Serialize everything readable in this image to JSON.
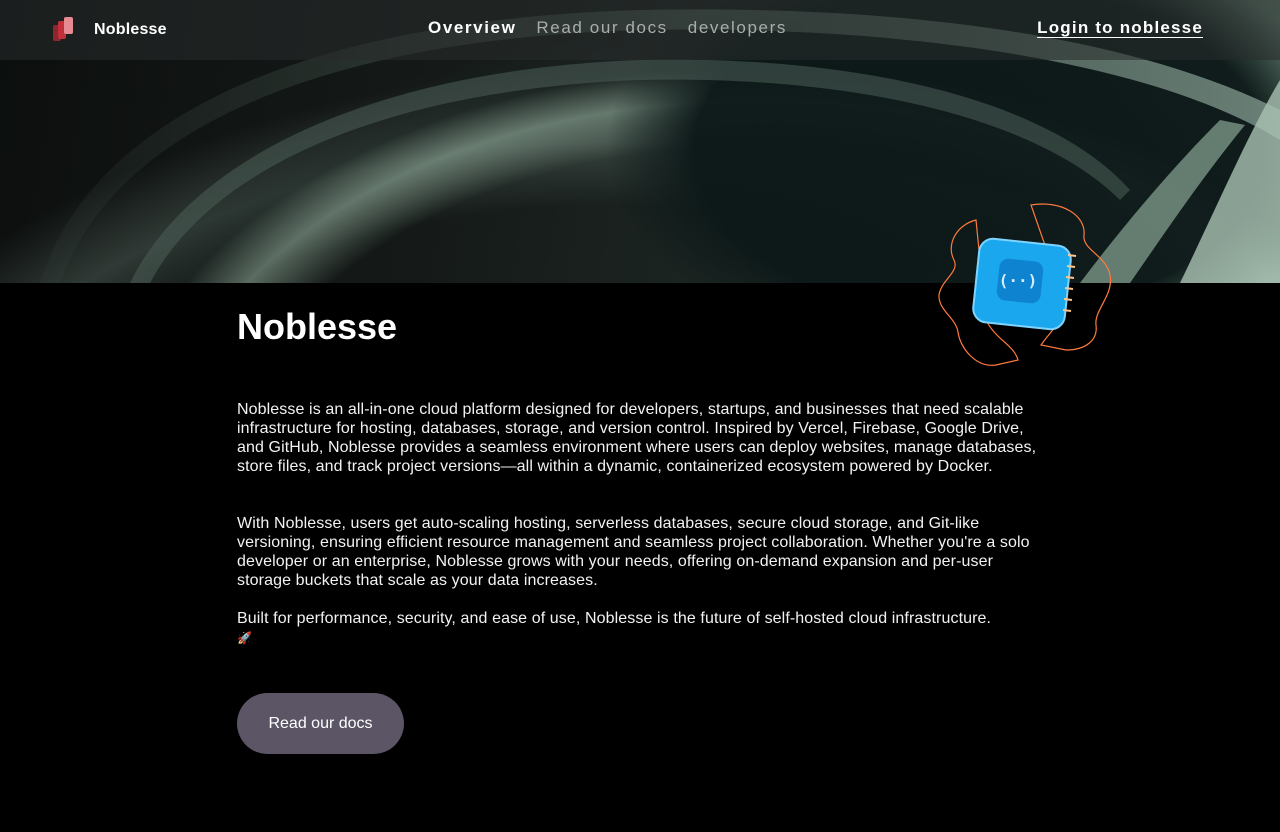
{
  "brand": {
    "name": "Noblesse",
    "logo_icon": "noblesse-logo-icon"
  },
  "nav": {
    "items": [
      {
        "label": "Overview",
        "active": true
      },
      {
        "label": "Read our docs",
        "active": false
      },
      {
        "label": "developers",
        "active": false
      }
    ],
    "login_label": "Login to noblesse"
  },
  "hero": {
    "illustration_icon": "api-chip-icon"
  },
  "main": {
    "title": "Noblesse",
    "paragraphs": [
      "Noblesse is an all-in-one cloud platform designed for developers, startups, and businesses that need scalable infrastructure for hosting, databases, storage, and version control. Inspired by Vercel, Firebase, Google Drive, and GitHub, Noblesse provides a seamless environment where users can deploy websites, manage databases, store files, and track project versions—all within a dynamic, containerized ecosystem powered by Docker.",
      "With Noblesse, users get auto-scaling hosting, serverless databases, secure cloud storage, and Git-like versioning, ensuring efficient resource management and seamless project collaboration. Whether you're a solo developer or an enterprise, Noblesse grows with your needs, offering on-demand expansion and per-user storage buckets that scale as your data increases.",
      "Built for performance, security, and ease of use, Noblesse is the future of self-hosted cloud infrastructure."
    ],
    "rocket_emoji": "🚀",
    "cta_label": "Read our docs"
  },
  "colors": {
    "background": "#000000",
    "button": "#5b5566",
    "chip_blue": "#1aa7ee",
    "chip_outline": "#ff7a3d",
    "logo_red": "#c0303a"
  }
}
